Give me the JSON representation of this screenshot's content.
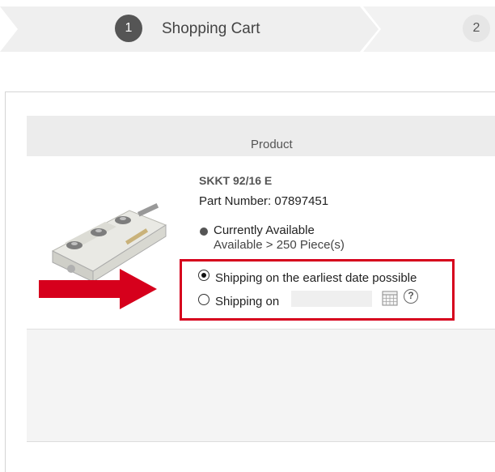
{
  "stepper": {
    "steps": [
      {
        "number": "1",
        "label": "Shopping Cart"
      },
      {
        "number": "2",
        "label": ""
      }
    ]
  },
  "table": {
    "header_product": "Product"
  },
  "product": {
    "name": "SKKT 92/16 E",
    "part_number": "Part Number: 07897451",
    "availability": "Currently Available",
    "availability_detail": "Available > 250 Piece(s)"
  },
  "shipping": {
    "option_earliest": "Shipping on the earliest date possible",
    "option_date": "Shipping on",
    "date_value": "",
    "selected": "earliest",
    "help_glyph": "?"
  },
  "colors": {
    "highlight": "#d6001c",
    "arrow": "#d6001c",
    "header_bg": "#ececec"
  },
  "icons": {
    "calendar": "calendar-icon",
    "help": "help-icon",
    "arrow": "arrow-right-icon"
  }
}
